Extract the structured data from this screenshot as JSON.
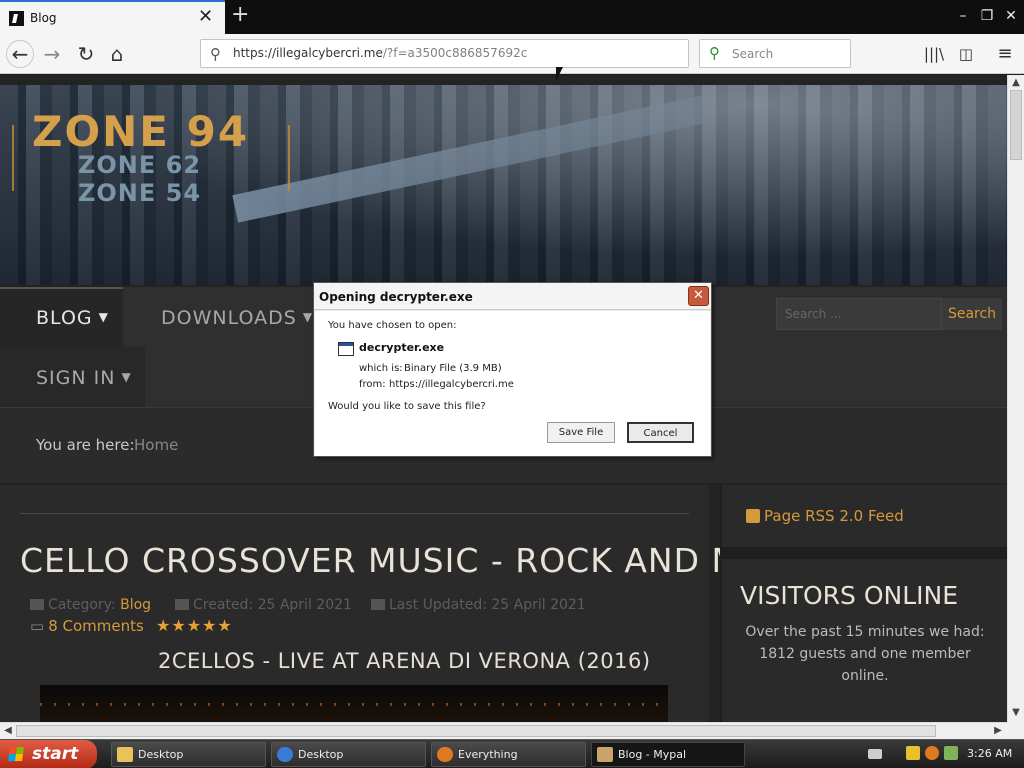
{
  "browser": {
    "tab": {
      "title": "Blog",
      "close": "✕"
    },
    "new_tab": "+",
    "window": {
      "minimize": "–",
      "restore": "❐",
      "close": "✕"
    },
    "nav": {
      "back": "←",
      "forward": "→",
      "reload": "↻",
      "home": "⌂"
    },
    "url": {
      "host": "https://illegalcybercri.me",
      "path": "/?f=a3500c886857692c"
    },
    "search_placeholder": "Search",
    "toolbar": {
      "library": "|||\\",
      "sidebar": "◫",
      "menu": "≡"
    }
  },
  "site": {
    "logo": {
      "main": "ZONE 94",
      "sub1": "ZONE 62",
      "sub2": "ZONE 54"
    },
    "menu": {
      "blog": "BLOG",
      "downloads": "DOWNLOADS",
      "sign_in": "SIGN IN"
    },
    "search": {
      "placeholder": "Search ...",
      "button": "Search"
    },
    "breadcrumb": {
      "label": "You are here:",
      "home": "Home"
    },
    "article": {
      "title": "CELLO CROSSOVER MUSIC - ROCK AND METAL",
      "category_label": "Category:",
      "category": "Blog",
      "created": "Created: 25 April 2021",
      "updated": "Last Updated: 25 April 2021",
      "comments": "8 Comments",
      "stars": "★★★★★",
      "video_title": "2CELLOS - LIVE AT ARENA DI VERONA (2016)"
    },
    "sidebar": {
      "rss": "Page RSS 2.0 Feed",
      "visitors_title": "VISITORS ONLINE",
      "visitors_text": "Over the past 15 minutes we had: 1812 guests and one member online."
    }
  },
  "dialog": {
    "title": "Opening decrypter.exe",
    "close": "✕",
    "intro": "You have chosen to open:",
    "file_name": "decrypter.exe",
    "which_is_label": "which is:",
    "which_is_value": "Binary File (3.9 MB)",
    "from_label": "from:",
    "from_value": "https://illegalcybercri.me",
    "question": "Would you like to save this file?",
    "save_button": "Save File",
    "cancel_button": "Cancel"
  },
  "taskbar": {
    "start": "start",
    "tasks": [
      {
        "label": "Desktop"
      },
      {
        "label": "Desktop"
      },
      {
        "label": "Everything"
      },
      {
        "label": "Blog - Mypal"
      }
    ],
    "clock": "3:26 AM"
  },
  "colors": {
    "accent": "#d59a3b",
    "dialog_close": "#c75a3c",
    "start_button": "#d2422b"
  }
}
